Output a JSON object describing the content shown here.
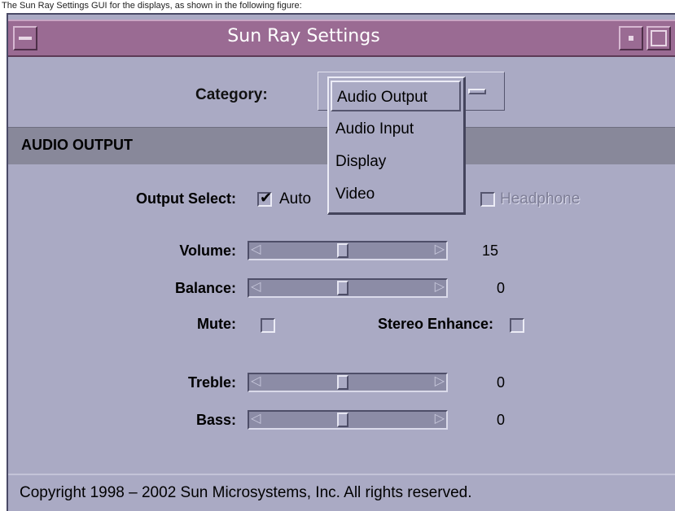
{
  "caption": "The Sun Ray Settings GUI for the displays, as shown in the following figure:",
  "window": {
    "title": "Sun Ray Settings"
  },
  "category": {
    "label": "Category:",
    "selected": "Audio Output",
    "options": [
      "Audio Output",
      "Audio Input",
      "Display",
      "Video"
    ]
  },
  "section": {
    "title": "AUDIO OUTPUT"
  },
  "output_select": {
    "label": "Output Select:",
    "auto": {
      "label": "Auto",
      "checked": true
    },
    "headphone": {
      "label": "Headphone",
      "checked": false,
      "disabled": true
    }
  },
  "sliders": {
    "volume": {
      "label": "Volume:",
      "value": "15"
    },
    "balance": {
      "label": "Balance:",
      "value": "0"
    },
    "treble": {
      "label": "Treble:",
      "value": "0"
    },
    "bass": {
      "label": "Bass:",
      "value": "0"
    }
  },
  "mute": {
    "label": "Mute:",
    "checked": false
  },
  "stereo_enhance": {
    "label": "Stereo Enhance:",
    "checked": false
  },
  "footer": {
    "copyright": "Copyright 1998 – 2002 Sun Microsystems, Inc.  All rights reserved."
  },
  "colors": {
    "window_bg": "#aaaac4",
    "titlebar": "#9a6b93",
    "section_band": "#88889a"
  }
}
